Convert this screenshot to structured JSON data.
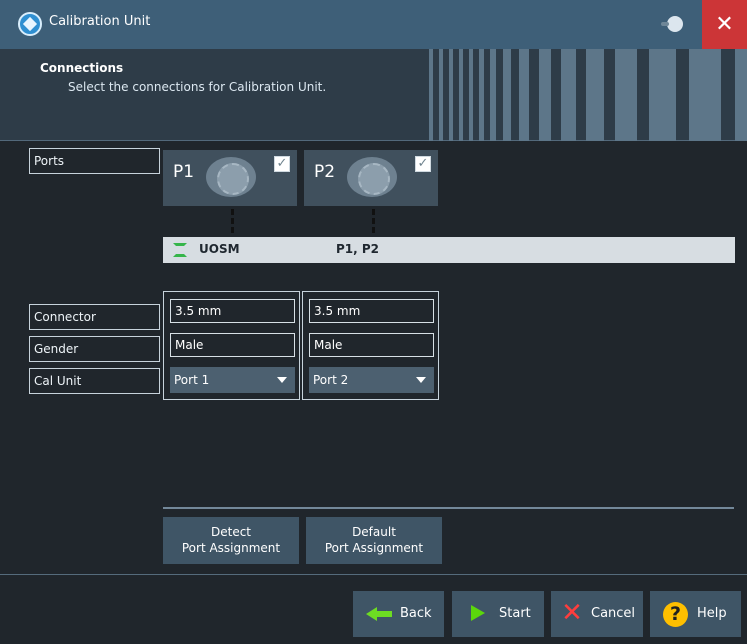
{
  "window": {
    "title": "Calibration Unit",
    "close_glyph": "✕"
  },
  "header": {
    "title": "Connections",
    "description": "Select the connections for Calibration Unit."
  },
  "labels": {
    "ports": "Ports",
    "connector": "Connector",
    "gender": "Gender",
    "cal_unit": "Cal Unit"
  },
  "ports": [
    {
      "name": "P1",
      "checked": true,
      "connector": "3.5 mm",
      "gender": "Male",
      "cal_unit_port": "Port 1"
    },
    {
      "name": "P2",
      "checked": true,
      "connector": "3.5 mm",
      "gender": "Male",
      "cal_unit_port": "Port 2"
    }
  ],
  "cal_unit": {
    "name": "UOSM",
    "ports": "P1, P2"
  },
  "buttons": {
    "detect_line1": "Detect",
    "detect_line2": "Port Assignment",
    "default_line1": "Default",
    "default_line2": "Port Assignment",
    "back": "Back",
    "start": "Start",
    "cancel": "Cancel",
    "help": "Help"
  },
  "icons": {
    "logo": "calibration-unit-logo-icon",
    "toggle": "toggle-icon",
    "close": "close-icon",
    "connector": "connector-icon",
    "checkbox": "checkbox-icon",
    "cal_unit": "cal-unit-icon",
    "back": "back-arrow-icon",
    "start": "start-icon",
    "cancel": "cancel-icon",
    "help": "help-icon"
  },
  "colors": {
    "title_bar": "#3e5f78",
    "close": "#cc3537",
    "background": "#20262c",
    "panel": "#40505d",
    "button": "#3f5566",
    "green": "#5bd70b",
    "red": "#ff3d3d",
    "help": "#ffbf00"
  }
}
